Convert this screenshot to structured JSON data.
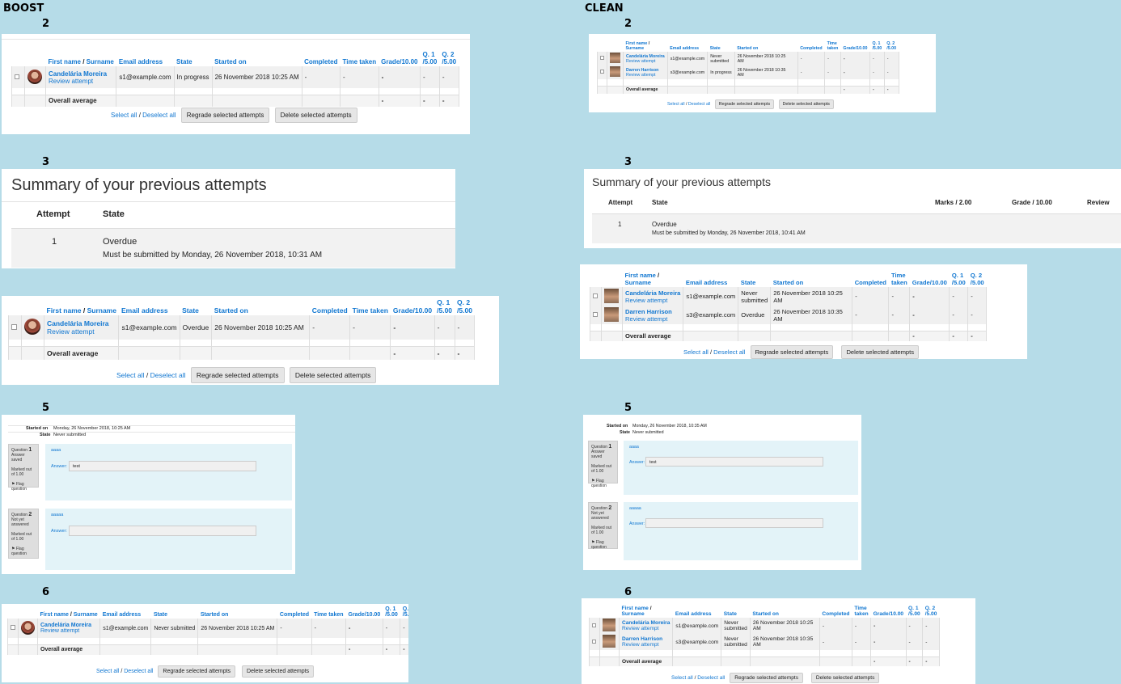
{
  "labels": {
    "boost": "BOOST",
    "clean": "CLEAN",
    "n2": "2",
    "n3": "3",
    "n5": "5",
    "n6": "6"
  },
  "cols": {
    "first": "First name",
    "slash": " / ",
    "surname": "Surname",
    "email": "Email address",
    "state": "State",
    "started": "Started on",
    "completed": "Completed",
    "time": "Time taken",
    "time1": "Time",
    "time2": "taken",
    "grade": "Grade/10.00",
    "q1a": "Q. 1",
    "q1b": "/5.00",
    "q2a": "Q. 2",
    "q2b": "/5.00"
  },
  "users": {
    "u1": {
      "name": "Candelária Moreira",
      "email": "s1@example.com"
    },
    "u2": {
      "name": "Darren Harrison",
      "email": "s3@example.com"
    }
  },
  "review": "Review attempt",
  "dash": "-",
  "overall": "Overall average",
  "footer": {
    "select": "Select all",
    "sep": " / ",
    "deselect": "Deselect all",
    "regrade": "Regrade selected attempts",
    "delete": "Delete selected attempts"
  },
  "states": {
    "inprogress": "In progress",
    "overdue": "Overdue",
    "never": "Never submitted",
    "never1": "Never",
    "never2": "submitted"
  },
  "dates": {
    "d1": "26 November 2018 10:25 AM",
    "d1a": "26 November 2018 10:25",
    "d2a": "26 November 2018 10:35",
    "am": "AM"
  },
  "summary": {
    "title": "Summary of your previous attempts",
    "attempt": "Attempt",
    "state": "State",
    "marks": "Marks / 2.00",
    "grade": "Grade / 10.00",
    "review": "Review",
    "num": "1",
    "overdue": "Overdue",
    "boost_due": "Must be submitted by Monday, 26 November 2018, 10:31 AM",
    "clean_due": "Must be submitted by Monday, 26 November 2018, 10:41 AM"
  },
  "quiz": {
    "started_label": "Started on",
    "state_label": "State",
    "never": "Never submitted",
    "boost_started": "Monday, 26 November 2018, 10:25 AM",
    "clean_started": "Monday, 26 November 2018, 10:35 AM",
    "question": "Question",
    "q1num": "1",
    "q2num": "2",
    "saved": "Answer saved",
    "notyet": "Not yet answered",
    "marked": "Marked out of 1.00",
    "flag": "Flag question",
    "q1text": "aaaa",
    "q2text": "aaaaa",
    "answer": "Answer:",
    "q1value": "test"
  }
}
